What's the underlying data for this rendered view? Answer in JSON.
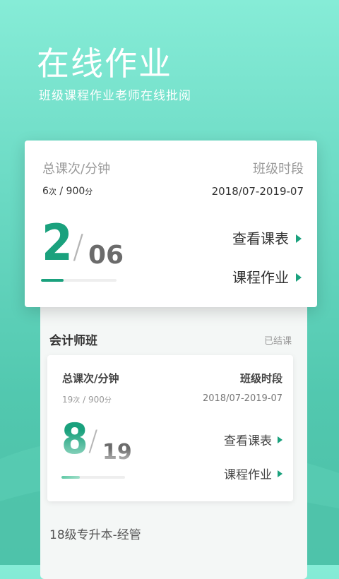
{
  "header": {
    "title": "在线作业",
    "subtitle": "班级课程作业老师在线批阅"
  },
  "featured_card": {
    "total_label": "总课次/分钟",
    "total_count": "6",
    "count_unit": "次",
    "separator": "/",
    "total_minutes": "900",
    "minutes_unit": "分",
    "period_label": "班级时段",
    "period_value": "2018/07-2019-07",
    "current_lesson": "2",
    "total_lessons": "06",
    "progress": 0.3,
    "schedule_link": "查看课表",
    "homework_link": "课程作业"
  },
  "class_card": {
    "class_name": "会计师班",
    "status": "已结课",
    "total_label": "总课次/分钟",
    "total_count": "19",
    "count_unit": "次",
    "separator": "/",
    "total_minutes": "900",
    "minutes_unit": "分",
    "period_label": "班级时段",
    "period_value": "2018/07-2019-07",
    "current_lesson": "8",
    "total_lessons": "19",
    "progress": 0.29,
    "schedule_link": "查看课表",
    "homework_link": "课程作业"
  },
  "next_class": {
    "class_name": "18级专升本-经管"
  },
  "colors": {
    "accent": "#1aa17d",
    "background_top": "#86ecd7",
    "background_bottom": "#4bbfa6"
  }
}
